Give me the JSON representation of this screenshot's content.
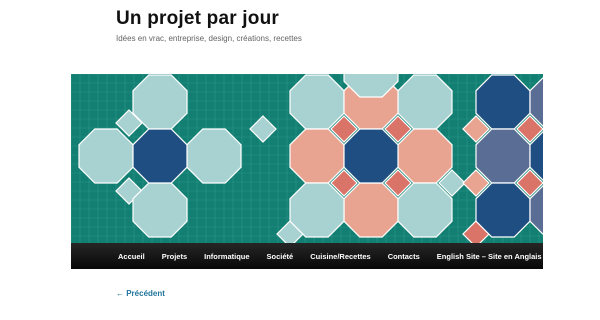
{
  "site": {
    "title": "Un projet par jour",
    "description": "Idées en vrac, entreprise, design, créations, recettes"
  },
  "header_image": {
    "icon": "geometric-tile-pattern",
    "colors": {
      "background": "#137f73",
      "grid_line": "#2a9488",
      "light_tile": "#a8d2d1",
      "salmon_tile": "#e8a490",
      "dark_tile": "#1f4f82",
      "slate_tile": "#5a6d94",
      "diamond": "#db7468"
    }
  },
  "nav": {
    "items": [
      {
        "label": "Accueil"
      },
      {
        "label": "Projets"
      },
      {
        "label": "Informatique"
      },
      {
        "label": "Société"
      },
      {
        "label": "Cuisine/Recettes"
      },
      {
        "label": "Contacts"
      },
      {
        "label": "English Site – Site en Anglais"
      }
    ]
  },
  "post_nav": {
    "previous_label": "← Précédent"
  }
}
